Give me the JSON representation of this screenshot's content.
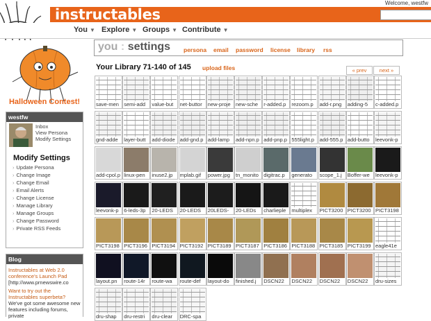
{
  "header": {
    "logo": "instructables",
    "welcome": "Welcome, westfw",
    "search_value": ""
  },
  "nav": [
    {
      "label": "You"
    },
    {
      "label": "Explore"
    },
    {
      "label": "Groups"
    },
    {
      "label": "Contribute"
    }
  ],
  "sidebar": {
    "contest": "Halloween Contest!",
    "user": {
      "name": "westfw",
      "links": [
        "Inbox",
        "View Persona",
        "Modify Settings"
      ]
    },
    "modify": {
      "title": "Modify Settings",
      "links": [
        "Update Persona",
        "Change Image",
        "Change Email",
        "Email Alerts",
        "Change License",
        "Manage Library",
        "Manage Groups",
        "Change Password",
        "Private RSS Feeds"
      ]
    },
    "blog": {
      "title": "Blog",
      "p1_link": "Instructables at Web 2.0 conference's Launch Pad",
      "p1_text": "[http://www.prnewswire.co",
      "p2_link": "Want to try out the Instructables superbeta?",
      "p2_text": "We've got some awesome new features including forums, private"
    }
  },
  "settings": {
    "you": "you",
    "sep": ":",
    "title": "settings",
    "tabs": [
      "persona",
      "email",
      "password",
      "license",
      "library",
      "rss"
    ]
  },
  "library": {
    "title": "Your Library 71-140 of 145",
    "upload": "upload files",
    "prev": "« prev",
    "next": "next »",
    "thumbs": [
      {
        "cap": "save-men",
        "c": "#ffffff"
      },
      {
        "cap": "semi-add",
        "c": "#f4f4f4"
      },
      {
        "cap": "value-but",
        "c": "#ffffff"
      },
      {
        "cap": "net-buttor",
        "c": "#ffffff"
      },
      {
        "cap": "new-proje",
        "c": "#f2f2f2"
      },
      {
        "cap": "new-sche",
        "c": "#f0f0f0"
      },
      {
        "cap": "r-added.p",
        "c": "#f6f6f6"
      },
      {
        "cap": "rezoom.p",
        "c": "#ffffff"
      },
      {
        "cap": "add-r.png",
        "c": "#f4f4f4"
      },
      {
        "cap": "adding-5",
        "c": "#eeeeee"
      },
      {
        "cap": "c-added.p",
        "c": "#ffffff"
      },
      {
        "cap": "gnd-adde",
        "c": "#f2f2f2"
      },
      {
        "cap": "layer-butt",
        "c": "#ffffff"
      },
      {
        "cap": "add-diode",
        "c": "#f0f0f0"
      },
      {
        "cap": "add-gnd.p",
        "c": "#eeeeee"
      },
      {
        "cap": "add-lamp",
        "c": "#f2f2f2"
      },
      {
        "cap": "add-npn.p",
        "c": "#eeeeee"
      },
      {
        "cap": "add-pnp.p",
        "c": "#f0f0f0"
      },
      {
        "cap": "555light.p",
        "c": "#ffffff"
      },
      {
        "cap": "add-555.p",
        "c": "#eeeeee"
      },
      {
        "cap": "add-butto",
        "c": "#ffffff"
      },
      {
        "cap": "leevonk-p",
        "c": "#f4f4f4"
      },
      {
        "cap": "add-cpol.p",
        "c": "#d8d8d8"
      },
      {
        "cap": "linux-pen",
        "c": "#8c7c6a"
      },
      {
        "cap": "inuse2.jp",
        "c": "#b8b4ac"
      },
      {
        "cap": "mplab.gif",
        "c": "#d4d4d4"
      },
      {
        "cap": "power.jpg",
        "c": "#3a3a3a"
      },
      {
        "cap": "tn_monito",
        "c": "#cfcfcf"
      },
      {
        "cap": "digitrac.p",
        "c": "#5a6a6a"
      },
      {
        "cap": "generato",
        "c": "#6a7a90"
      },
      {
        "cap": "scope_1.j",
        "c": "#333333"
      },
      {
        "cap": "Boffer-we",
        "c": "#6a8a4a"
      },
      {
        "cap": "leevonk-p",
        "c": "#1a1a1a"
      },
      {
        "cap": "leevonk-p",
        "c": "#1a1a2a"
      },
      {
        "cap": "6-leds-3p",
        "c": "#1a1a1a"
      },
      {
        "cap": "20-LEDS",
        "c": "#202020"
      },
      {
        "cap": "20-LEDS",
        "c": "#1a1a1a"
      },
      {
        "cap": "20LEDS-",
        "c": "#1c1c1c"
      },
      {
        "cap": "20-LEDs",
        "c": "#151515"
      },
      {
        "cap": "charlieple",
        "c": "#1a1a1a"
      },
      {
        "cap": "multiplex",
        "c": "#ffffff"
      },
      {
        "cap": "PICT3200",
        "c": "#b08a40"
      },
      {
        "cap": "PICT3200",
        "c": "#8c6a30"
      },
      {
        "cap": "PICT3198",
        "c": "#a07838"
      },
      {
        "cap": "PICT3198",
        "c": "#b89858"
      },
      {
        "cap": "PICT3196",
        "c": "#a88848"
      },
      {
        "cap": "PICT3194",
        "c": "#b09050"
      },
      {
        "cap": "PICT3192",
        "c": "#c0a060"
      },
      {
        "cap": "PICT3189",
        "c": "#a88848"
      },
      {
        "cap": "PICT3187",
        "c": "#b09858"
      },
      {
        "cap": "PICT3186",
        "c": "#a08040"
      },
      {
        "cap": "PICT3188",
        "c": "#b89858"
      },
      {
        "cap": "PICT3185",
        "c": "#a88848"
      },
      {
        "cap": "PICT3199",
        "c": "#b89850"
      },
      {
        "cap": "eagle41e",
        "c": "#ffffff"
      },
      {
        "cap": "layout.pn",
        "c": "#101020"
      },
      {
        "cap": "route-14r",
        "c": "#101828"
      },
      {
        "cap": "route-wa",
        "c": "#101010"
      },
      {
        "cap": "route-def",
        "c": "#101820"
      },
      {
        "cap": "layout-do",
        "c": "#0a0a0a"
      },
      {
        "cap": "finished.j",
        "c": "#888888"
      },
      {
        "cap": "DSCN22",
        "c": "#907050"
      },
      {
        "cap": "DSCN22",
        "c": "#b08060"
      },
      {
        "cap": "DSCN22",
        "c": "#a07050"
      },
      {
        "cap": "DSCN22",
        "c": "#c09070"
      },
      {
        "cap": "dru-sizes",
        "c": "#f4f4f4"
      },
      {
        "cap": "dru-shap",
        "c": "#f2f2f2"
      },
      {
        "cap": "dru-restri",
        "c": "#f4f4f4"
      },
      {
        "cap": "dru-clear",
        "c": "#f2f2f2"
      },
      {
        "cap": "DRC-spa",
        "c": "#f6f6f6"
      }
    ]
  }
}
